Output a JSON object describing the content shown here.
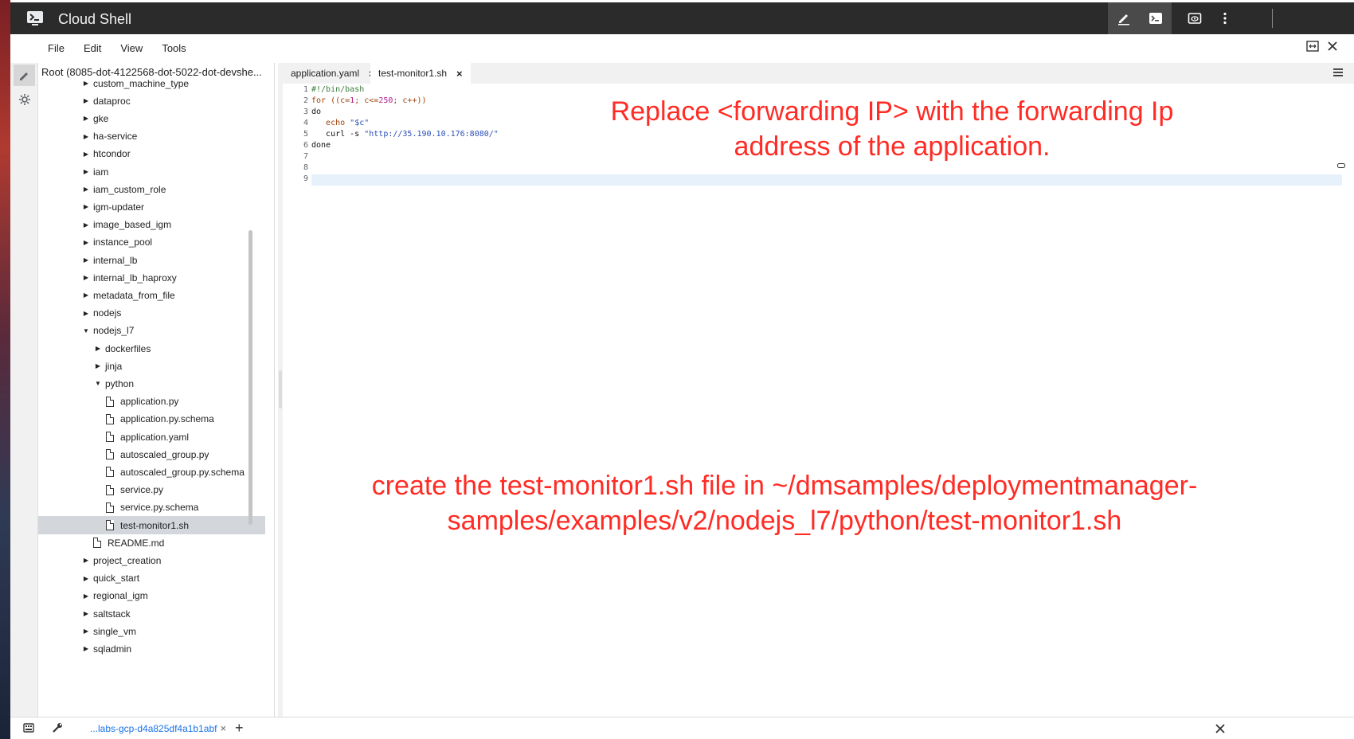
{
  "titlebar": {
    "title": "Cloud Shell"
  },
  "menu": [
    "File",
    "Edit",
    "View",
    "Tools"
  ],
  "file_panel": {
    "root_label": "Root (8085-dot-4122568-dot-5022-dot-devshe...",
    "items": [
      {
        "label": "custom_machine_type",
        "type": "folder",
        "depth": 1,
        "open": false
      },
      {
        "label": "dataproc",
        "type": "folder",
        "depth": 1,
        "open": false
      },
      {
        "label": "gke",
        "type": "folder",
        "depth": 1,
        "open": false
      },
      {
        "label": "ha-service",
        "type": "folder",
        "depth": 1,
        "open": false
      },
      {
        "label": "htcondor",
        "type": "folder",
        "depth": 1,
        "open": false
      },
      {
        "label": "iam",
        "type": "folder",
        "depth": 1,
        "open": false
      },
      {
        "label": "iam_custom_role",
        "type": "folder",
        "depth": 1,
        "open": false
      },
      {
        "label": "igm-updater",
        "type": "folder",
        "depth": 1,
        "open": false
      },
      {
        "label": "image_based_igm",
        "type": "folder",
        "depth": 1,
        "open": false
      },
      {
        "label": "instance_pool",
        "type": "folder",
        "depth": 1,
        "open": false
      },
      {
        "label": "internal_lb",
        "type": "folder",
        "depth": 1,
        "open": false
      },
      {
        "label": "internal_lb_haproxy",
        "type": "folder",
        "depth": 1,
        "open": false
      },
      {
        "label": "metadata_from_file",
        "type": "folder",
        "depth": 1,
        "open": false
      },
      {
        "label": "nodejs",
        "type": "folder",
        "depth": 1,
        "open": false
      },
      {
        "label": "nodejs_l7",
        "type": "folder",
        "depth": 1,
        "open": true
      },
      {
        "label": "dockerfiles",
        "type": "folder",
        "depth": 2,
        "open": false
      },
      {
        "label": "jinja",
        "type": "folder",
        "depth": 2,
        "open": false
      },
      {
        "label": "python",
        "type": "folder",
        "depth": 2,
        "open": true
      },
      {
        "label": "application.py",
        "type": "file",
        "depth": 3
      },
      {
        "label": "application.py.schema",
        "type": "file",
        "depth": 3
      },
      {
        "label": "application.yaml",
        "type": "file",
        "depth": 3
      },
      {
        "label": "autoscaled_group.py",
        "type": "file",
        "depth": 3
      },
      {
        "label": "autoscaled_group.py.schema",
        "type": "file",
        "depth": 3
      },
      {
        "label": "service.py",
        "type": "file",
        "depth": 3
      },
      {
        "label": "service.py.schema",
        "type": "file",
        "depth": 3
      },
      {
        "label": "test-monitor1.sh",
        "type": "file",
        "depth": 3,
        "selected": true
      },
      {
        "label": "README.md",
        "type": "file",
        "depth": 2
      },
      {
        "label": "project_creation",
        "type": "folder",
        "depth": 1,
        "open": false
      },
      {
        "label": "quick_start",
        "type": "folder",
        "depth": 1,
        "open": false
      },
      {
        "label": "regional_igm",
        "type": "folder",
        "depth": 1,
        "open": false
      },
      {
        "label": "saltstack",
        "type": "folder",
        "depth": 1,
        "open": false
      },
      {
        "label": "single_vm",
        "type": "folder",
        "depth": 1,
        "open": false
      },
      {
        "label": "sqladmin",
        "type": "folder",
        "depth": 1,
        "open": false
      }
    ]
  },
  "editor": {
    "tabs": [
      {
        "label": "application.yaml",
        "close": "×"
      },
      {
        "label": "test-monitor1.sh",
        "close": "×"
      }
    ],
    "line_numbers": [
      "1",
      "2",
      "3",
      "4",
      "5",
      "6",
      "7",
      "8",
      "9"
    ],
    "code_lines": [
      "#!/bin/bash",
      "for ((c=1; c<=250; c++))",
      "do",
      "   echo \"$c\"",
      "   curl -s \"http://35.190.10.176:8080/\"",
      "done",
      "",
      "",
      ""
    ]
  },
  "annotations": {
    "note1": "Replace <forwarding IP> with the forwarding Ip address of the application.",
    "note2": "create the test-monitor1.sh file in ~/dmsamples/deploymentmanager-samples/examples/v2/nodejs_l7/python/test-monitor1.sh"
  },
  "bottombar": {
    "session_tab": "...labs-gcp-d4a825df4a1b1abf",
    "close": "×",
    "add": "+"
  },
  "colors": {
    "titlebar": "#2b2b2b",
    "annotation": "#ff2b24",
    "selected_row": "#d3d7db"
  }
}
